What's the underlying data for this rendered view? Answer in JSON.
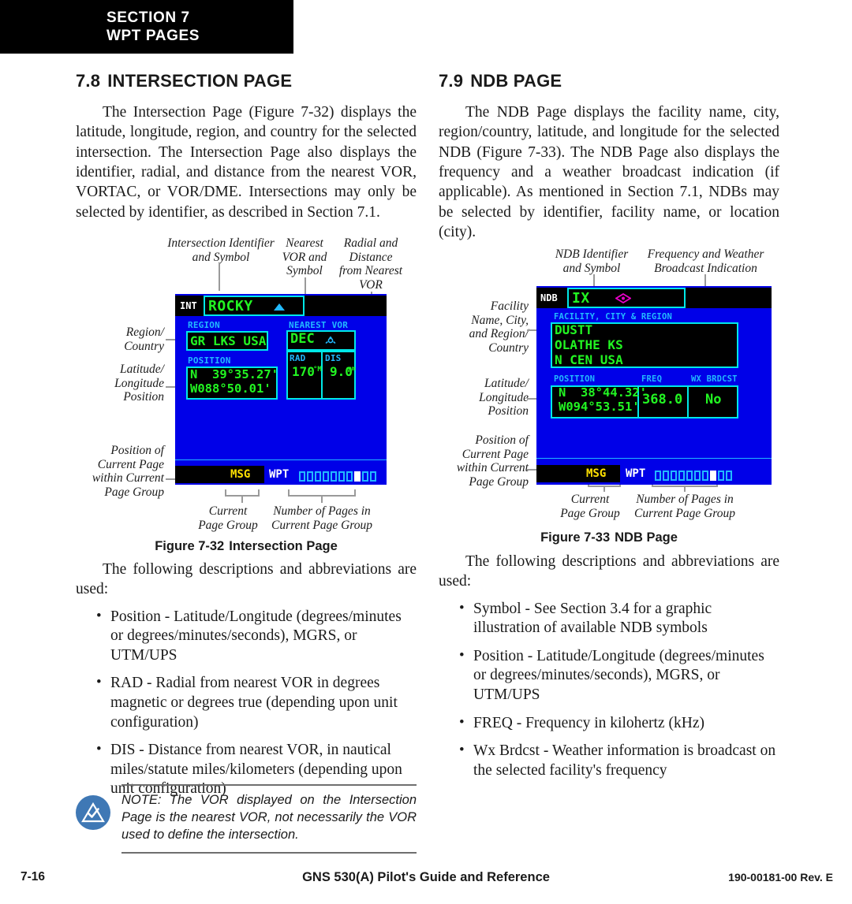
{
  "section_tab": {
    "line1": "SECTION 7",
    "line2": "WPT PAGES"
  },
  "left_column": {
    "heading_num": "7.8",
    "heading_text": "INTERSECTION PAGE",
    "intro": "The Intersection Page (Figure 7-32) displays the latitude, longitude, region, and country for the selected intersection.  The Intersection Page also displays the identifier, radial, and distance from the nearest VOR, VORTAC, or VOR/DME.  Intersections may only be selected by identifier, as described in Section 7.1.",
    "figure": {
      "caption_num": "Figure 7-32",
      "caption_text": "Intersection Page",
      "callouts": {
        "identifier": "Intersection Identifier\nand Symbol",
        "nearest_vor": "Nearest\nVOR and\nSymbol",
        "radial_distance": "Radial and\nDistance\nfrom Nearest\nVOR",
        "region_country": "Region/\nCountry",
        "lat_lon": "Latitude/\nLongitude\nPosition",
        "page_position": "Position of\nCurrent Page\nwithin Current\nPage Group",
        "current_page_group": "Current\nPage Group",
        "number_of_pages": "Number of Pages in\nCurrent Page Group"
      },
      "screen": {
        "type_tag": "INT",
        "identifier": "ROCKY",
        "identifier_symbol": "intersection-triangle-symbol",
        "region_label": "REGION",
        "region_value": "GR LKS USA",
        "position_label": "POSITION",
        "lat_value": "N  39°35.27'",
        "lon_value": "W088°50.01'",
        "nearest_vor_label": "NEAREST VOR",
        "nearest_vor_value": "DEC",
        "vor_symbol": "vor-compass-symbol",
        "rad_label": "RAD",
        "rad_value": "170",
        "rad_unit": "°M",
        "dis_label": "DIS",
        "dis_value": "9.0",
        "dis_unit": "nm",
        "msg_label": "MSG",
        "wpt_label": "WPT",
        "page_total": 10,
        "page_active_index": 7
      }
    },
    "list_intro": "The following descriptions and abbreviations are used:",
    "bullets": [
      "Position - Latitude/Longitude (degrees/minutes or degrees/minutes/seconds), MGRS, or UTM/UPS",
      "RAD - Radial from nearest VOR in degrees magnetic or degrees true (depending upon unit configuration)",
      "DIS - Distance from nearest VOR, in nautical miles/statute miles/kilometers (depending upon unit configuration)"
    ],
    "note": {
      "icon": "note-checkmark-triangle-icon",
      "text": "NOTE:  The VOR displayed on the Intersection Page is the nearest VOR, not necessarily the VOR used to define the intersection."
    }
  },
  "right_column": {
    "heading_num": "7.9",
    "heading_text": "NDB PAGE",
    "intro": "The NDB Page displays the facility name, city, region/country, latitude, and longitude for the selected NDB (Figure 7-33).  The NDB Page also displays the frequency and a weather broadcast indication (if applicable).  As mentioned in Section 7.1, NDBs may be selected by identifier, facility name, or location (city).",
    "figure": {
      "caption_num": "Figure 7-33",
      "caption_text": "NDB Page",
      "callouts": {
        "identifier": "NDB Identifier\nand Symbol",
        "freq_wx": "Frequency and Weather\nBroadcast Indication",
        "facility": "Facility\nName, City,\nand Region/\nCountry",
        "lat_lon": "Latitude/\nLongitude\nPosition",
        "page_position": "Position of\nCurrent Page\nwithin Current\nPage Group",
        "current_page_group": "Current\nPage Group",
        "number_of_pages": "Number of Pages in\nCurrent Page Group"
      },
      "screen": {
        "type_tag": "NDB",
        "identifier": "IX",
        "identifier_symbol": "ndb-symbol",
        "facility_label": "FACILITY, CITY & REGION",
        "facility_line1": "DUSTT",
        "facility_line2": "OLATHE KS",
        "facility_line3": "N CEN USA",
        "position_label": "POSITION",
        "lat_value": "N  38°44.32'",
        "lon_value": "W094°53.51'",
        "freq_label": "FREQ",
        "freq_value": "368.0",
        "wx_label": "WX BRDCST",
        "wx_value": "No",
        "msg_label": "MSG",
        "wpt_label": "WPT",
        "page_total": 10,
        "page_active_index": 7
      }
    },
    "list_intro": "The following descriptions and abbreviations are used:",
    "bullets": [
      "Symbol - See Section 3.4 for a graphic illustration of available NDB symbols",
      "Position - Latitude/Longitude (degrees/minutes or degrees/minutes/seconds), MGRS, or UTM/UPS",
      "FREQ - Frequency in kilohertz (kHz)",
      "Wx Brdcst - Weather information is broadcast on the selected facility's frequency"
    ]
  },
  "footer": {
    "page_number": "7-16",
    "title": "GNS 530(A) Pilot's Guide and Reference",
    "doc_number": "190-00181-00  Rev. E"
  },
  "colors": {
    "screen_bg": "#0000e8",
    "field_bg": "#000000",
    "field_border": "#00e8e8",
    "label_blue": "#22b9ff",
    "value_green": "#22f522",
    "msg_yellow": "#ffe100",
    "ndb_symbol": "#e800c8",
    "note_icon": "#3f78b5"
  }
}
